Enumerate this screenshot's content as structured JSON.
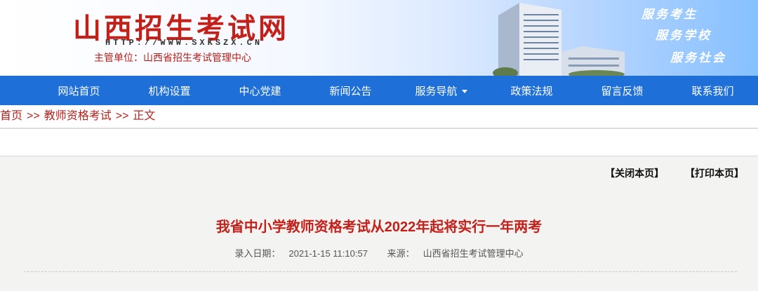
{
  "header": {
    "title": "山西招生考试网",
    "url": "HTTP://WWW.SXKSZX.CN",
    "org": "主管单位：山西省招生考试管理中心",
    "slogans": [
      "服务考生",
      "服务学校",
      "服务社会"
    ]
  },
  "nav": {
    "items": [
      "网站首页",
      "机构设置",
      "中心党建",
      "新闻公告",
      "服务导航",
      "政策法规",
      "留言反馈",
      "联系我们"
    ]
  },
  "breadcrumb": {
    "home": "首页",
    "sep": ">>",
    "section": "教师资格考试",
    "current": "正文"
  },
  "article": {
    "close_label": "【关闭本页】",
    "print_label": "【打印本页】",
    "title": "我省中小学教师资格考试从2022年起将实行一年两考",
    "date_label": "录入日期：",
    "date": "2021-1-15 11:10:57",
    "source_label": "来源：",
    "source": "山西省招生考试管理中心"
  },
  "colors": {
    "brand_red": "#c4201a",
    "nav_blue": "#1e6fd8"
  }
}
